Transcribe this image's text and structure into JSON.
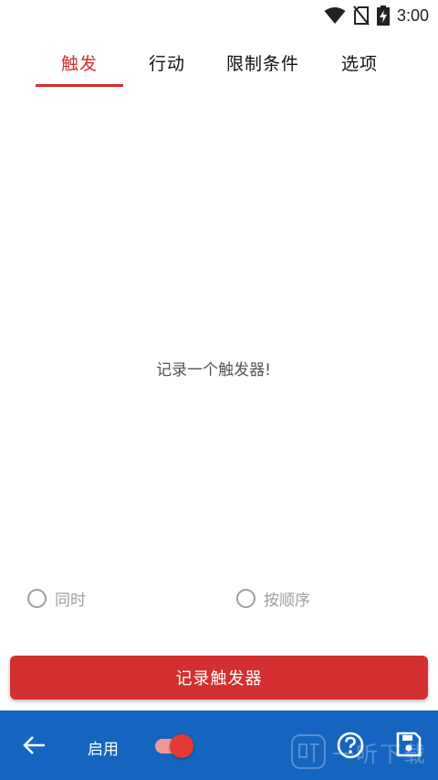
{
  "status_bar": {
    "time": "3:00"
  },
  "tabs": [
    {
      "label": "触发",
      "active": true
    },
    {
      "label": "行动",
      "active": false
    },
    {
      "label": "限制条件",
      "active": false
    },
    {
      "label": "选项",
      "active": false
    }
  ],
  "content": {
    "empty_message": "记录一个触发器!"
  },
  "trigger_mode": {
    "options": [
      {
        "label": "同时",
        "selected": false
      },
      {
        "label": "按顺序",
        "selected": false
      }
    ]
  },
  "record_button": {
    "label": "记录触发器"
  },
  "bottom_bar": {
    "enable_label": "启用",
    "enable_toggle_on": true,
    "icons": [
      "back-arrow-icon",
      "help-icon",
      "save-icon"
    ]
  },
  "watermark": {
    "text": "一听下载"
  },
  "colors": {
    "accent_red": "#d32f2f",
    "bottom_bar_blue": "#1565c0",
    "inactive_gray": "#9e9e9e"
  }
}
